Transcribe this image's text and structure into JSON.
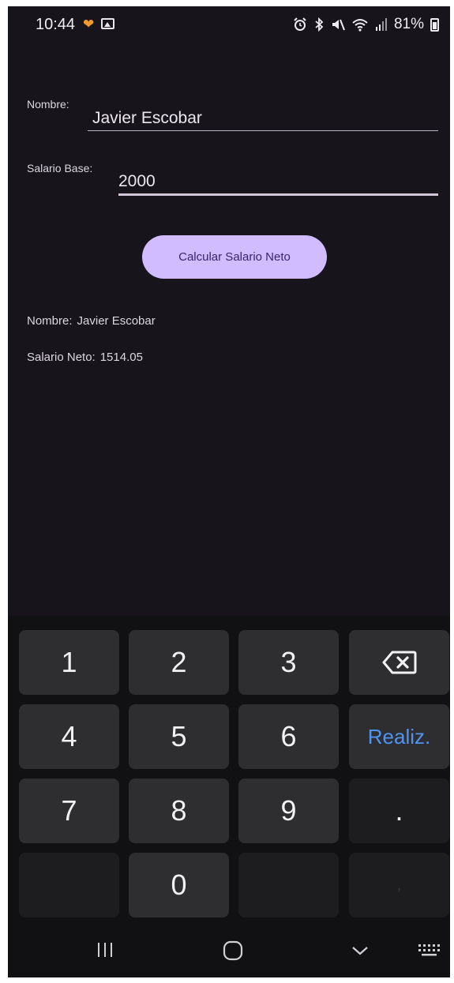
{
  "status_bar": {
    "time": "10:44",
    "battery": "81%",
    "icons": [
      "notification-heart-icon",
      "gallery-icon",
      "alarm-icon",
      "bluetooth-icon",
      "mute-icon",
      "wifi-icon",
      "signal-icon",
      "battery-icon"
    ]
  },
  "form": {
    "nombre_label": "Nombre:",
    "nombre_value": "Javier Escobar",
    "salario_label": "Salario Base:",
    "salario_value": "2000"
  },
  "button": {
    "label": "Calcular Salario Neto",
    "color": "#d1bcff"
  },
  "results": {
    "nombre_label": "Nombre:",
    "nombre_value": "Javier Escobar",
    "neto_label": "Salario Neto:",
    "neto_value": "1514.05"
  },
  "keyboard": {
    "keys": [
      "1",
      "2",
      "3",
      "4",
      "5",
      "6",
      "7",
      "8",
      "9",
      "0"
    ],
    "done_label": "Realiz.",
    "dot_label": ".",
    "comma_label": ",",
    "done_color": "#4e94f0"
  }
}
